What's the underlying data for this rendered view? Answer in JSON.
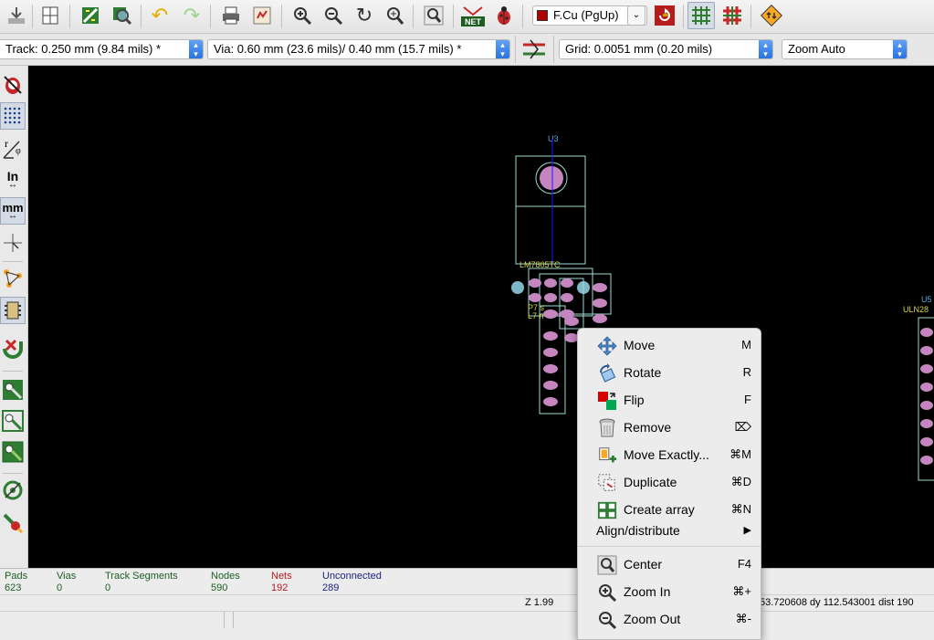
{
  "toolbar": {
    "icons": [
      "board-setup-icon",
      "page-settings-icon",
      "new-board-icon",
      "find-icon",
      "undo-icon",
      "redo-icon",
      "print-icon",
      "plot-icon",
      "zoom-in-icon",
      "zoom-out-icon",
      "redraw-icon",
      "zoom-fit-icon",
      "zoom-selection-icon",
      "netlist-icon",
      "drc-icon",
      "layer-color-swatch",
      "layer-dropdown-icon",
      "layer-pair-icon",
      "grid-snap-icon",
      "track-grid-icon",
      "script-icon"
    ],
    "layer_select": "F.Cu (PgUp)",
    "layer_color": "#b00000",
    "net_badge": "NET"
  },
  "options": {
    "track": "Track: 0.250 mm (9.84 mils) *",
    "via": "Via: 0.60 mm (23.6 mils)/ 0.40 mm (15.7 mils) *",
    "grid": "Grid: 0.0051 mm (0.20 mils)",
    "zoom": "Zoom Auto",
    "accent": "#2b72de"
  },
  "left_toolbar": {
    "units_in": "In",
    "units_mm": "mm",
    "polar_r": "r",
    "polar_phi": "φ"
  },
  "canvas": {
    "labels": {
      "u3": "U3",
      "u5": "U5",
      "uln": "ULN28",
      "cluster1": "LM7805TC",
      "cluster2": "P7   s",
      "cluster3": "L7   n"
    },
    "colors": {
      "pad": "#c586c0",
      "via": "#7fb6c8",
      "silk": "#9fd9d0",
      "ratsnest": "#1a1aff",
      "ref": "#56a6d8",
      "value": "#d6d63d"
    }
  },
  "status": {
    "cols": [
      {
        "label": "Pads",
        "value": "623",
        "color": "#1b5e20"
      },
      {
        "label": "Vias",
        "value": "0",
        "color": "#1b5e20"
      },
      {
        "label": "Track Segments",
        "value": "0",
        "color": "#1b5e20"
      },
      {
        "label": "Nodes",
        "value": "590",
        "color": "#1b5e20"
      },
      {
        "label": "Nets",
        "value": "192",
        "color": "#b71c1c"
      },
      {
        "label": "Unconnected",
        "value": "289",
        "color": "#1a237e"
      }
    ],
    "zoom": "Z 1.99",
    "coords": "53.720608  dy 112.543001  dist 190"
  },
  "context_menu": {
    "items": [
      {
        "label": "Move",
        "shortcut": "M",
        "icon": "move-icon"
      },
      {
        "label": "Rotate",
        "shortcut": "R",
        "icon": "rotate-icon"
      },
      {
        "label": "Flip",
        "shortcut": "F",
        "icon": "flip-icon"
      },
      {
        "label": "Remove",
        "shortcut": "⌦",
        "icon": "trash-icon"
      },
      {
        "label": "Move Exactly...",
        "shortcut": "⌘M",
        "icon": "move-exactly-icon"
      },
      {
        "label": "Duplicate",
        "shortcut": "⌘D",
        "icon": "duplicate-icon"
      },
      {
        "label": "Create array",
        "shortcut": "⌘N",
        "icon": "array-icon"
      }
    ],
    "submenu_label": "Align/distribute",
    "submenu_arrow": "▶",
    "zoom_items": [
      {
        "label": "Center",
        "shortcut": "F4",
        "icon": "center-icon"
      },
      {
        "label": "Zoom In",
        "shortcut": "⌘+",
        "icon": "zoom-in-icon"
      },
      {
        "label": "Zoom Out",
        "shortcut": "⌘-",
        "icon": "zoom-out-icon"
      }
    ]
  }
}
